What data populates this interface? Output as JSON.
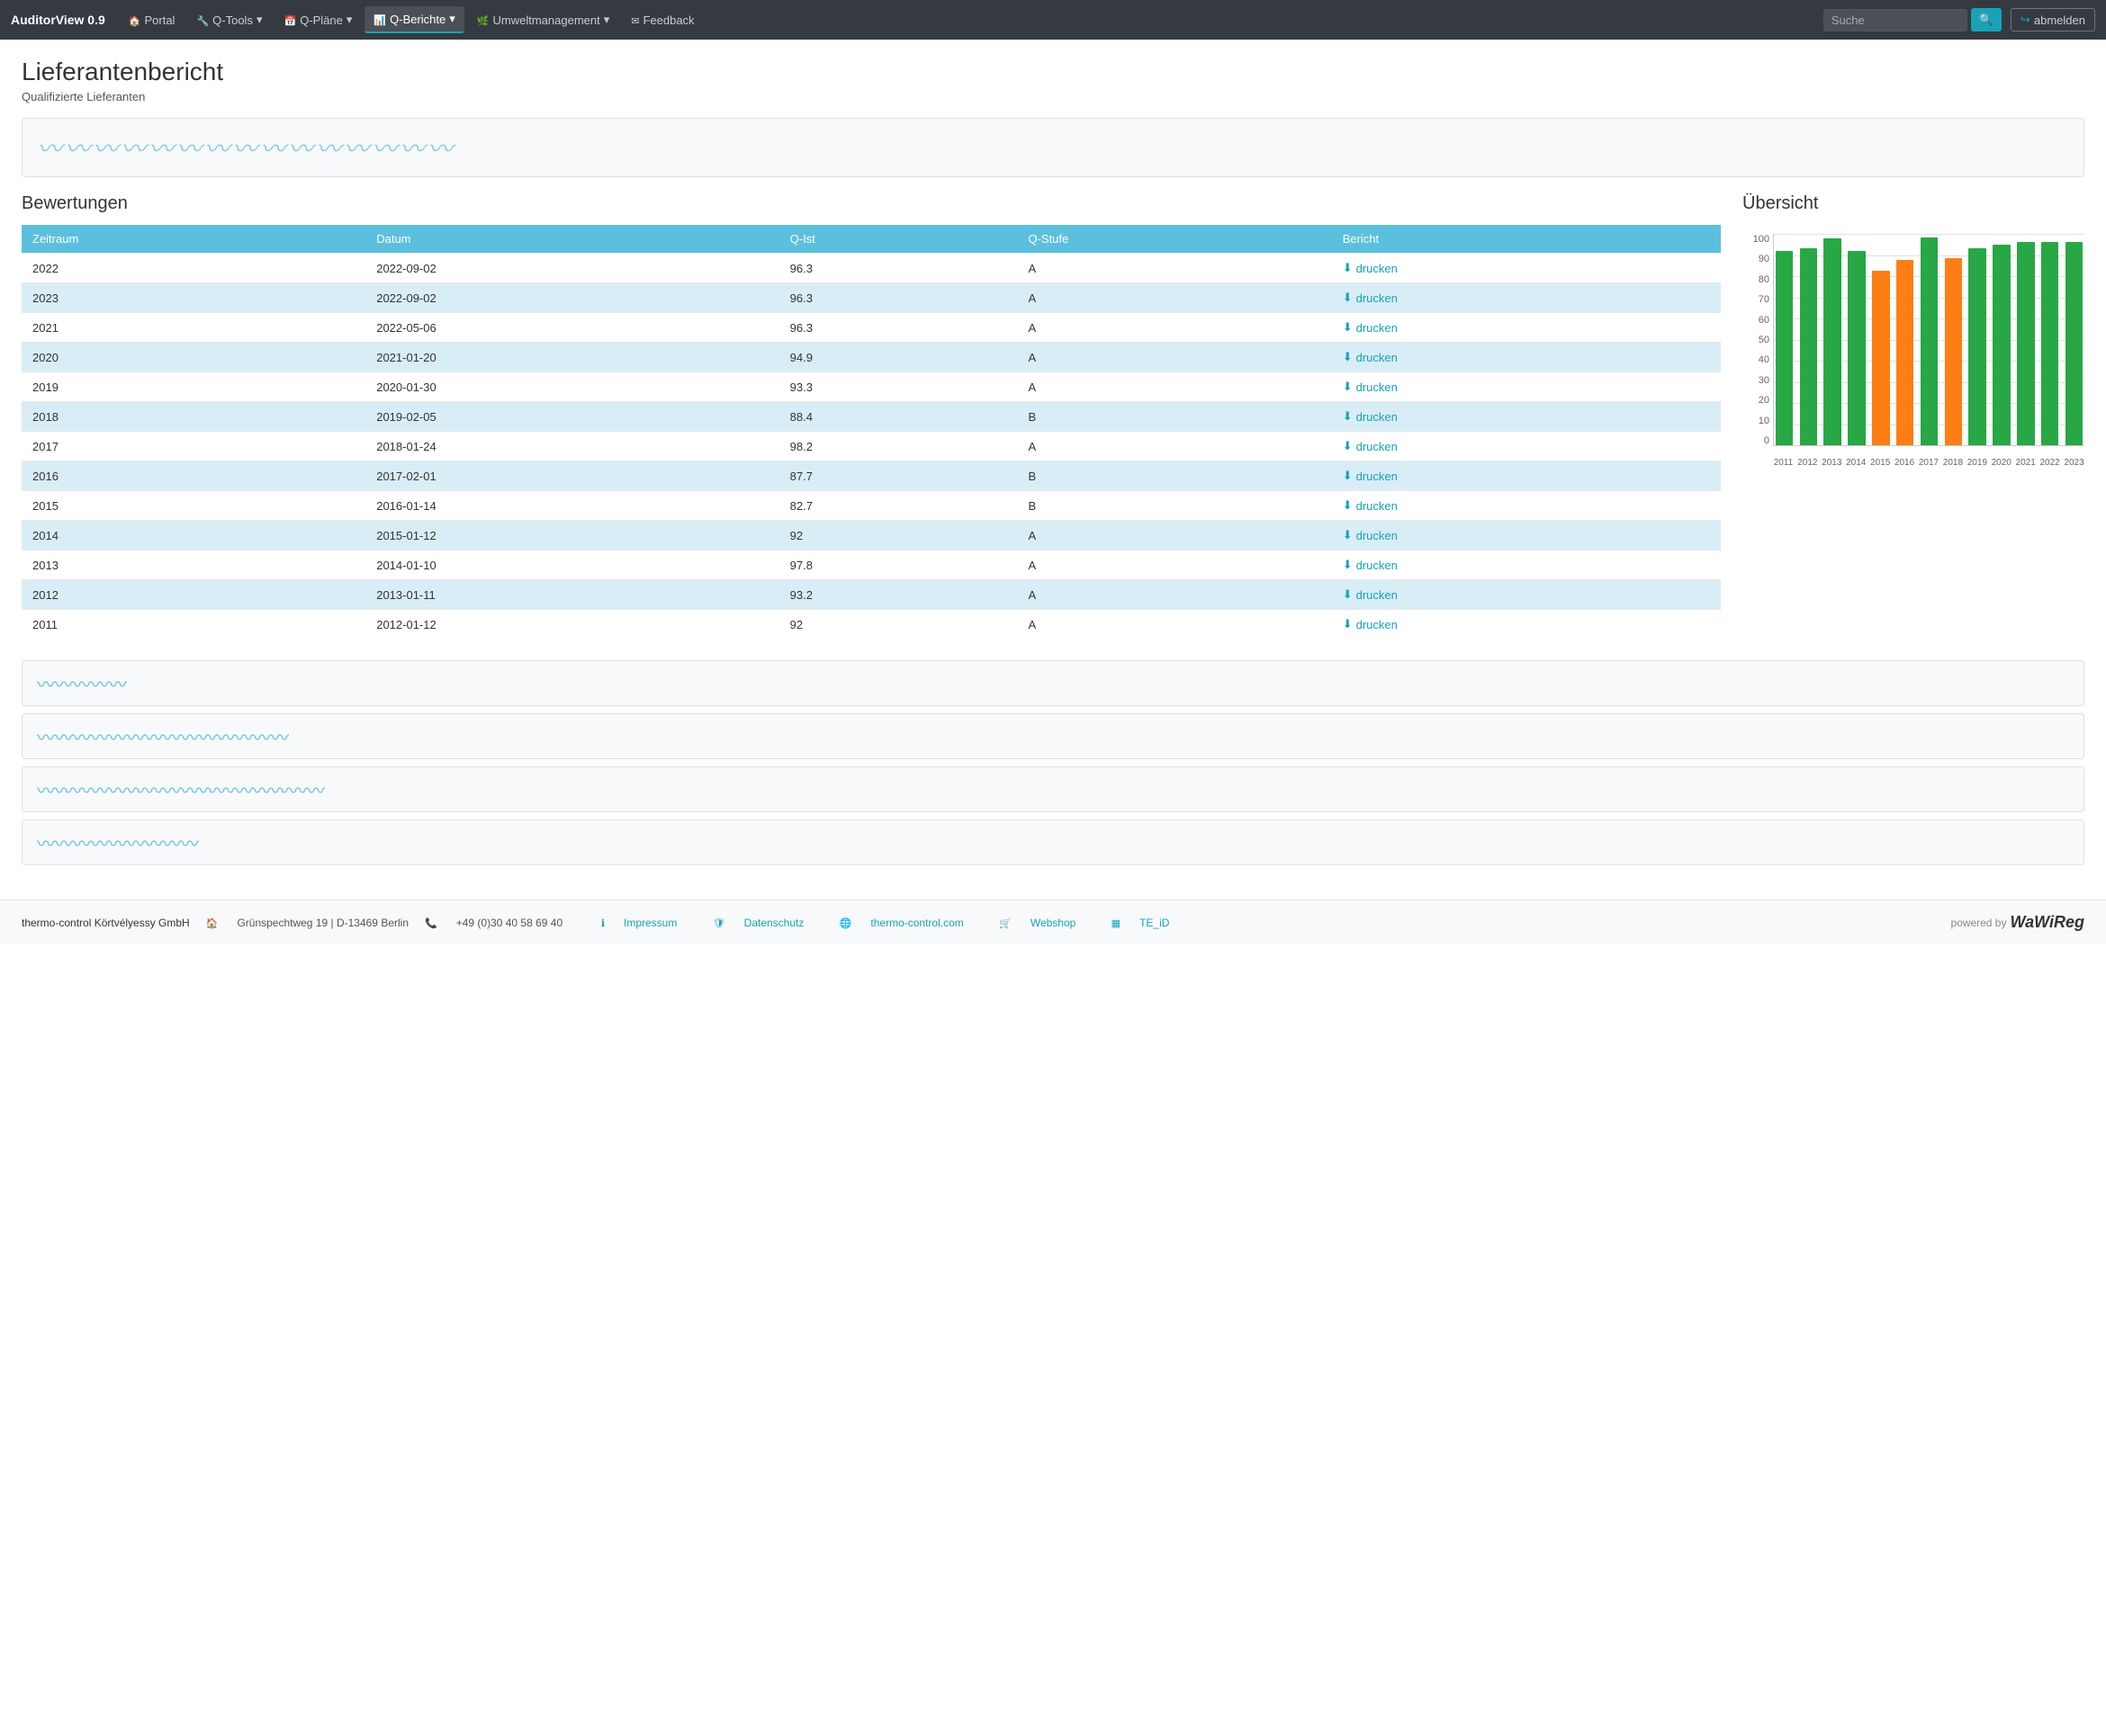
{
  "app": {
    "brand": "AuditorView 0.9",
    "search_placeholder": "Suche"
  },
  "navbar": {
    "items": [
      {
        "label": "Portal",
        "icon": "home-icon",
        "active": false
      },
      {
        "label": "Q-Tools",
        "icon": "tools-icon",
        "active": false,
        "dropdown": true
      },
      {
        "label": "Q-Pläne",
        "icon": "calendar-icon",
        "active": false,
        "dropdown": true
      },
      {
        "label": "Q-Berichte",
        "icon": "chart-icon",
        "active": true,
        "dropdown": true
      },
      {
        "label": "Umweltmanagement",
        "icon": "leaf-icon",
        "active": false,
        "dropdown": true
      },
      {
        "label": "Feedback",
        "icon": "mail-icon",
        "active": false
      }
    ],
    "logout_label": "abmelden"
  },
  "page": {
    "title": "Lieferantenbericht",
    "subtitle": "Qualifizierte Lieferanten"
  },
  "bewertungen": {
    "title": "Bewertungen",
    "columns": [
      "Zeitraum",
      "Datum",
      "Q-Ist",
      "Q-Stufe",
      "Bericht"
    ],
    "rows": [
      {
        "zeitraum": "2022",
        "datum": "2022-09-02",
        "q_ist": "96.3",
        "q_stufe": "A",
        "bericht": "drucken"
      },
      {
        "zeitraum": "2023",
        "datum": "2022-09-02",
        "q_ist": "96.3",
        "q_stufe": "A",
        "bericht": "drucken"
      },
      {
        "zeitraum": "2021",
        "datum": "2022-05-06",
        "q_ist": "96.3",
        "q_stufe": "A",
        "bericht": "drucken"
      },
      {
        "zeitraum": "2020",
        "datum": "2021-01-20",
        "q_ist": "94.9",
        "q_stufe": "A",
        "bericht": "drucken"
      },
      {
        "zeitraum": "2019",
        "datum": "2020-01-30",
        "q_ist": "93.3",
        "q_stufe": "A",
        "bericht": "drucken"
      },
      {
        "zeitraum": "2018",
        "datum": "2019-02-05",
        "q_ist": "88.4",
        "q_stufe": "B",
        "bericht": "drucken"
      },
      {
        "zeitraum": "2017",
        "datum": "2018-01-24",
        "q_ist": "98.2",
        "q_stufe": "A",
        "bericht": "drucken"
      },
      {
        "zeitraum": "2016",
        "datum": "2017-02-01",
        "q_ist": "87.7",
        "q_stufe": "B",
        "bericht": "drucken"
      },
      {
        "zeitraum": "2015",
        "datum": "2016-01-14",
        "q_ist": "82.7",
        "q_stufe": "B",
        "bericht": "drucken"
      },
      {
        "zeitraum": "2014",
        "datum": "2015-01-12",
        "q_ist": "92",
        "q_stufe": "A",
        "bericht": "drucken"
      },
      {
        "zeitraum": "2013",
        "datum": "2014-01-10",
        "q_ist": "97.8",
        "q_stufe": "A",
        "bericht": "drucken"
      },
      {
        "zeitraum": "2012",
        "datum": "2013-01-11",
        "q_ist": "93.2",
        "q_stufe": "A",
        "bericht": "drucken"
      },
      {
        "zeitraum": "2011",
        "datum": "2012-01-12",
        "q_ist": "92",
        "q_stufe": "A",
        "bericht": "drucken"
      }
    ]
  },
  "uebersicht": {
    "title": "Übersicht",
    "y_labels": [
      "0",
      "10",
      "20",
      "30",
      "40",
      "50",
      "60",
      "70",
      "80",
      "90",
      "100"
    ],
    "bars": [
      {
        "year": "2011",
        "value": 92,
        "color": "green"
      },
      {
        "year": "2012",
        "value": 93.2,
        "color": "green"
      },
      {
        "year": "2013",
        "value": 97.8,
        "color": "green"
      },
      {
        "year": "2014",
        "value": 92,
        "color": "green"
      },
      {
        "year": "2015",
        "value": 82.7,
        "color": "orange"
      },
      {
        "year": "2016",
        "value": 87.7,
        "color": "orange"
      },
      {
        "year": "2017",
        "value": 98.2,
        "color": "green"
      },
      {
        "year": "2018",
        "value": 88.4,
        "color": "orange"
      },
      {
        "year": "2019",
        "value": 93.3,
        "color": "green"
      },
      {
        "year": "2020",
        "value": 94.9,
        "color": "green"
      },
      {
        "year": "2021",
        "value": 96.3,
        "color": "green"
      },
      {
        "year": "2022",
        "value": 96.3,
        "color": "green"
      },
      {
        "year": "2023",
        "value": 96.3,
        "color": "green"
      }
    ]
  },
  "footer": {
    "company": "thermo-control Körtvélyessy GmbH",
    "address": "Grünspechtweg 19 | D-13469 Berlin",
    "phone": "+49 (0)30 40 58 69 40",
    "links": [
      {
        "label": "Impressum",
        "icon": "info-icon"
      },
      {
        "label": "Datenschutz",
        "icon": "shield-icon"
      },
      {
        "label": "thermo-control.com",
        "icon": "globe-icon"
      },
      {
        "label": "Webshop",
        "icon": "cart-icon"
      },
      {
        "label": "TE_iD",
        "icon": "barcode-icon"
      }
    ],
    "powered_by": "powered by",
    "brand": "WaWiReg"
  }
}
